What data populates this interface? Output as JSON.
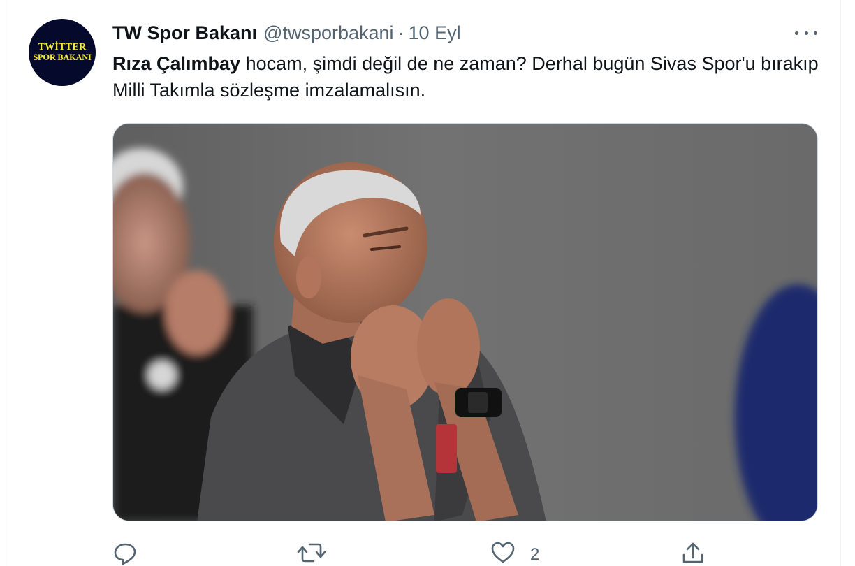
{
  "tweet": {
    "display_name": "TW Spor Bakanı",
    "handle": "@twsporbakani",
    "separator": "·",
    "date": "10 Eyl",
    "avatar": {
      "line1": "TWİTTER",
      "line2": "SPOR BAKANI",
      "background": "#050a2c",
      "text_color": "#f6ec33"
    },
    "text_bold": "Rıza Çalımbay",
    "text_rest": " hocam, şimdi değil de ne zaman? Derhal bugün Sivas Spor'u bırakıp Milli Takımla sözleşme imzalamalısın.",
    "media": {
      "type": "photo",
      "description_icon": "photo-image"
    },
    "actions": {
      "reply_icon": "reply-icon",
      "retweet_icon": "retweet-icon",
      "like_icon": "heart-icon",
      "like_count": "2",
      "share_icon": "share-icon"
    },
    "more_icon": "more-dots-icon"
  },
  "colors": {
    "primary_text": "#0f1419",
    "secondary_text": "#536471",
    "border": "#cfd9de"
  }
}
